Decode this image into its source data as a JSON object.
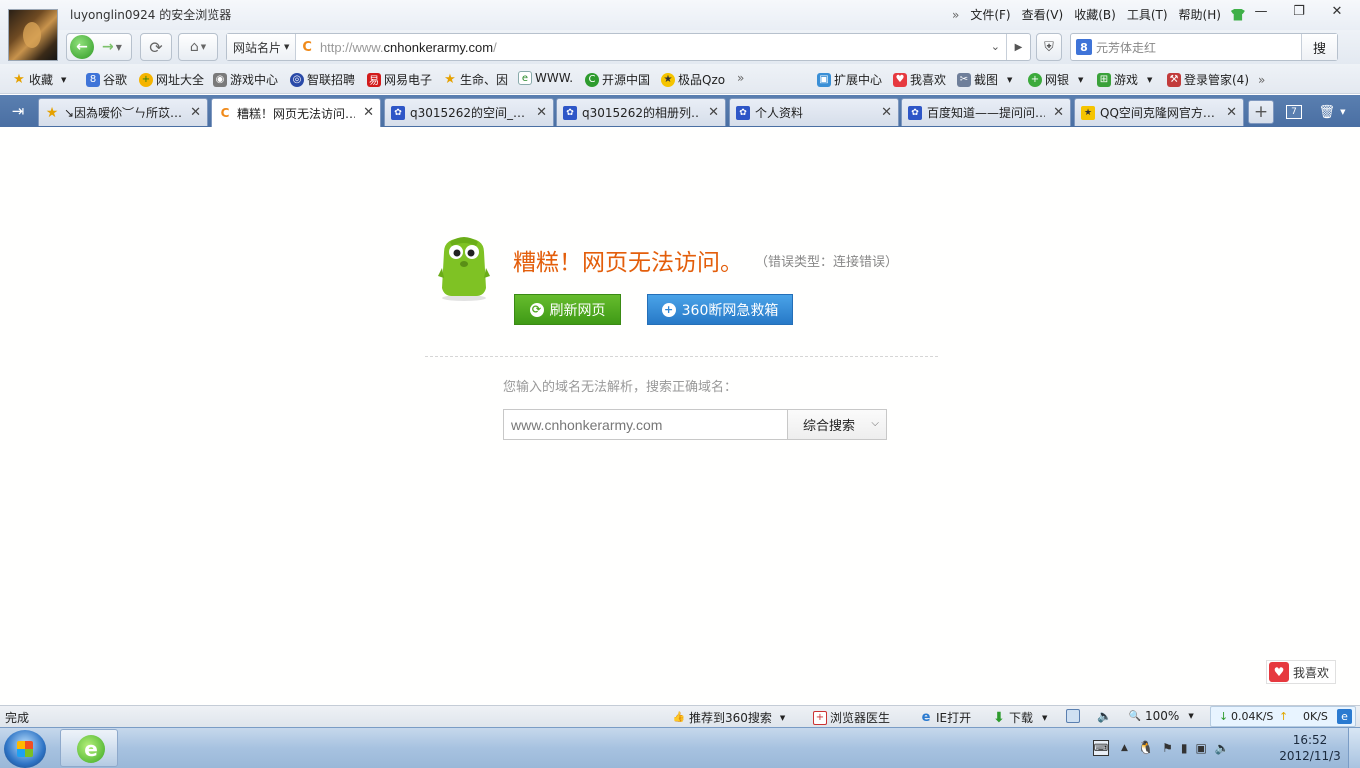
{
  "window": {
    "title": "luyonglin0924 的安全浏览器",
    "menu": [
      "文件(F)",
      "查看(V)",
      "收藏(B)",
      "工具(T)",
      "帮助(H)"
    ],
    "menu_more": "»",
    "controls": {
      "minimize": "—",
      "restore": "❐",
      "close": "✕"
    }
  },
  "navbar": {
    "site_card_label": "网站名片",
    "url_prefix": "http://www.",
    "url_host": "cnhonkerarmy.com",
    "url_suffix": "/",
    "search_placeholder": "元芳体走红",
    "search_button": "搜"
  },
  "favorites": {
    "items": [
      "收藏",
      "谷歌",
      "网址大全",
      "游戏中心",
      "智联招聘",
      "网易电子",
      "生命、因",
      "WWW.",
      "开源中国",
      "极品Qzo"
    ],
    "more": "»",
    "right_items": [
      "扩展中心",
      "我喜欢",
      "截图",
      "网银",
      "游戏",
      "登录管家(4)"
    ]
  },
  "tabs": [
    {
      "label": "↘因為嗳伱︶ㄣ所苡…"
    },
    {
      "label": "糟糕！网页无法访问…"
    },
    {
      "label": "q3015262的空间_…"
    },
    {
      "label": "q3015262的相册列…"
    },
    {
      "label": "个人资料"
    },
    {
      "label": "百度知道——提问问…"
    },
    {
      "label": "QQ空间克隆网官方…"
    }
  ],
  "tab_counts": {
    "closed_tabs": "7"
  },
  "error_page": {
    "title": "糟糕！网页无法访问。",
    "error_type": "（错误类型：连接错误）",
    "refresh_button": "刷新网页",
    "rescue_button": "360断网急救箱",
    "hint": "您输入的域名无法解析，搜索正确域名：",
    "domain_value": "www.cnhonkerarmy.com",
    "search_select": "综合搜索",
    "like_button": "我喜欢"
  },
  "statusbar": {
    "status": "完成",
    "recommend": "推荐到360搜索",
    "doctor": "浏览器医生",
    "ie_open": "IE打开",
    "download": "下载",
    "zoom": "100%",
    "down_speed": "0.04K/S",
    "up_speed": "0K/S"
  },
  "taskbar": {
    "time": "16:52",
    "date": "2012/11/3"
  },
  "colors": {
    "error_orange": "#e35e0b",
    "refresh_green": "#4fa81f",
    "rescue_blue": "#2f86d3",
    "tabbar_blue": "#4f74a8"
  }
}
